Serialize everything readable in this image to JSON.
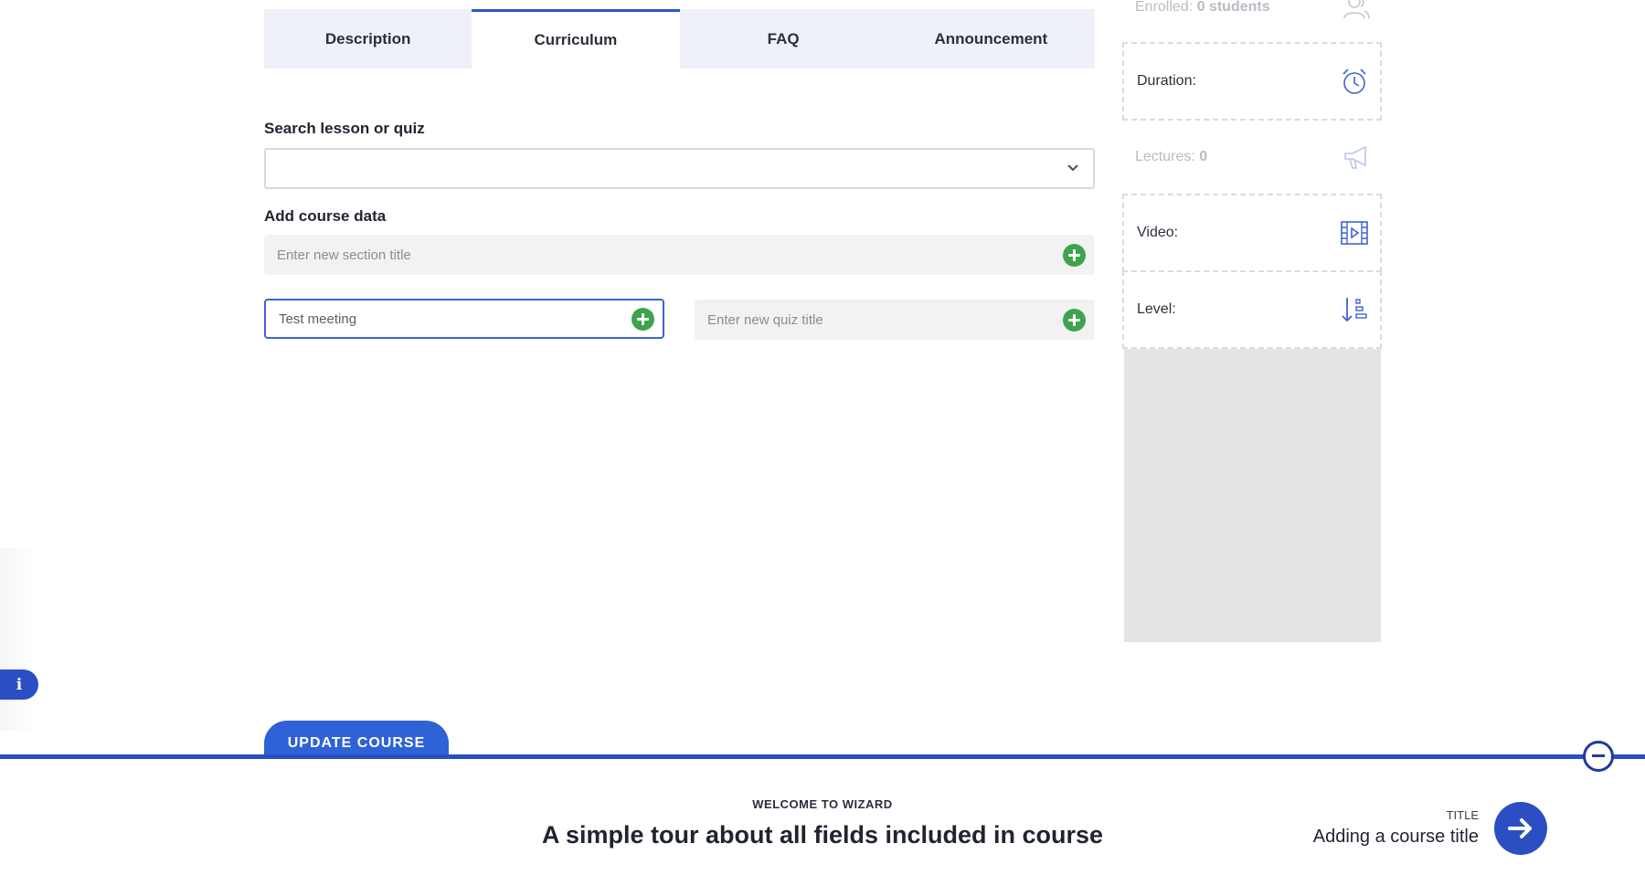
{
  "tabs": [
    {
      "label": "Description"
    },
    {
      "label": "Curriculum"
    },
    {
      "label": "FAQ"
    },
    {
      "label": "Announcement"
    }
  ],
  "active_tab": "Curriculum",
  "search": {
    "label": "Search lesson or quiz",
    "value": ""
  },
  "course_data": {
    "label": "Add course data",
    "section_placeholder": "Enter new section title",
    "lesson_value": "Test meeting",
    "quiz_placeholder": "Enter new quiz title"
  },
  "sidebar": {
    "enrolled_label": "Enrolled:",
    "enrolled_value": "0 students",
    "duration_label": "Duration:",
    "lectures_label": "Lectures:",
    "lectures_value": "0",
    "video_label": "Video:",
    "level_label": "Level:"
  },
  "update_button": "UPDATE COURSE",
  "info_icon": "i",
  "wizard": {
    "kicker": "WELCOME TO WIZARD",
    "title": "A simple tour about all fields included in course",
    "next_label": "TITLE",
    "next_title": "Adding a course title"
  },
  "icons": {
    "enrolled": "users-icon",
    "duration": "alarm-clock-icon",
    "lectures": "megaphone-icon",
    "video": "film-play-icon",
    "level": "sort-level-icon"
  },
  "colors": {
    "accent": "#2c4ec3",
    "button": "#2f62d6",
    "plus": "#3fa34d",
    "tabs_bg": "#eef1f7",
    "panel_grey": "#e3e4e6"
  }
}
